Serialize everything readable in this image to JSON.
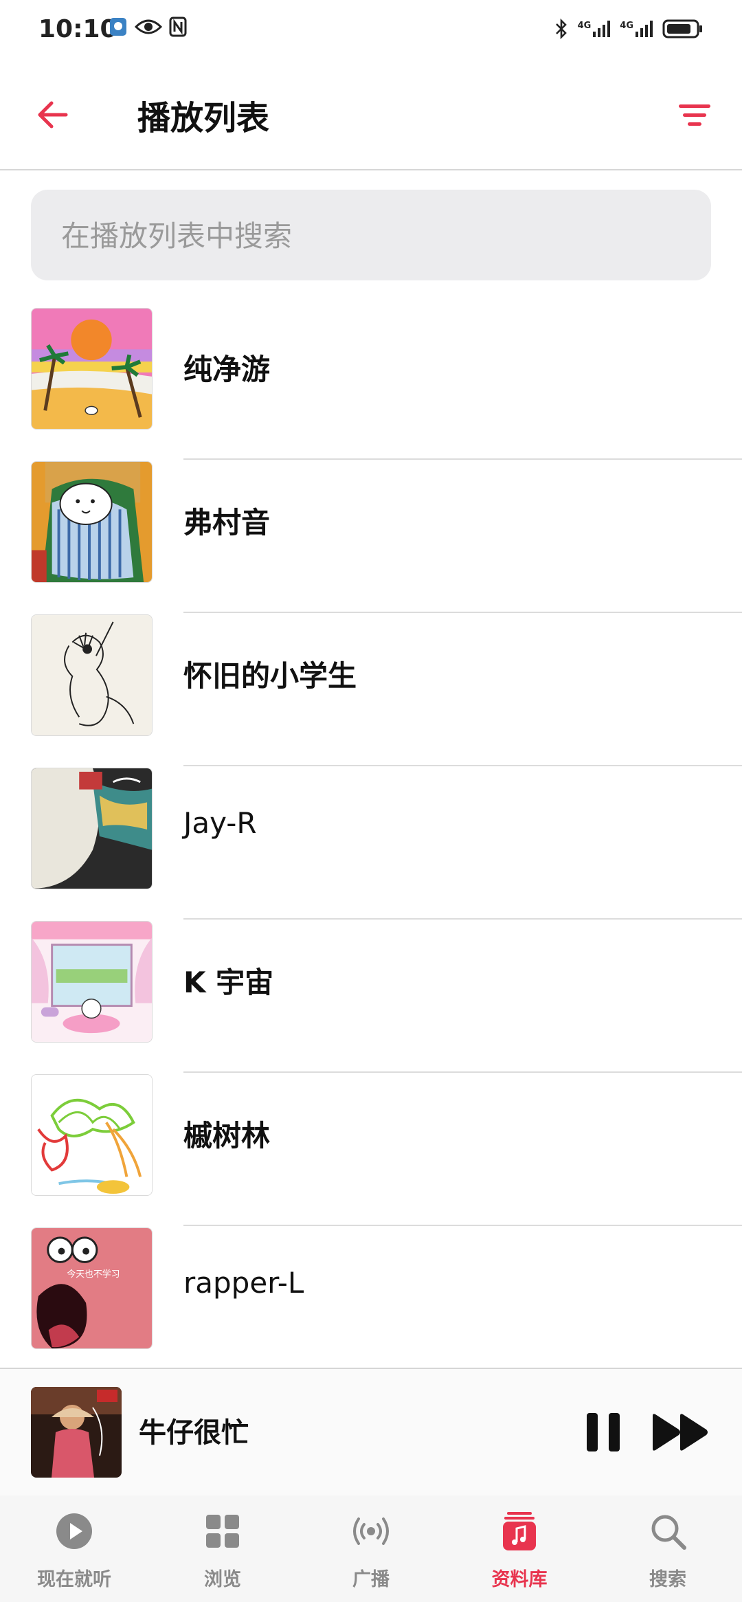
{
  "status_bar": {
    "time": "10:10",
    "network_1": "4G",
    "network_2": "4G"
  },
  "header": {
    "title": "播放列表"
  },
  "search": {
    "placeholder": "在播放列表中搜索"
  },
  "playlists": [
    {
      "title": "纯净游"
    },
    {
      "title": "弗村音"
    },
    {
      "title": "怀旧的小学生"
    },
    {
      "title": "Jay-R"
    },
    {
      "title": " K 宇宙"
    },
    {
      "title": "槭树林"
    },
    {
      "title": "rapper-L"
    }
  ],
  "cover_texts": {
    "rapper_l": "今天也不学习"
  },
  "now_playing": {
    "title": "牛仔很忙"
  },
  "tabs": [
    {
      "label": "现在就听",
      "icon": "play-circle-icon"
    },
    {
      "label": "浏览",
      "icon": "grid-icon"
    },
    {
      "label": "广播",
      "icon": "radio-icon"
    },
    {
      "label": "资料库",
      "icon": "library-icon"
    },
    {
      "label": "搜索",
      "icon": "search-icon"
    }
  ],
  "colors": {
    "accent": "#e8344e",
    "inactive": "#8a8a8a"
  }
}
